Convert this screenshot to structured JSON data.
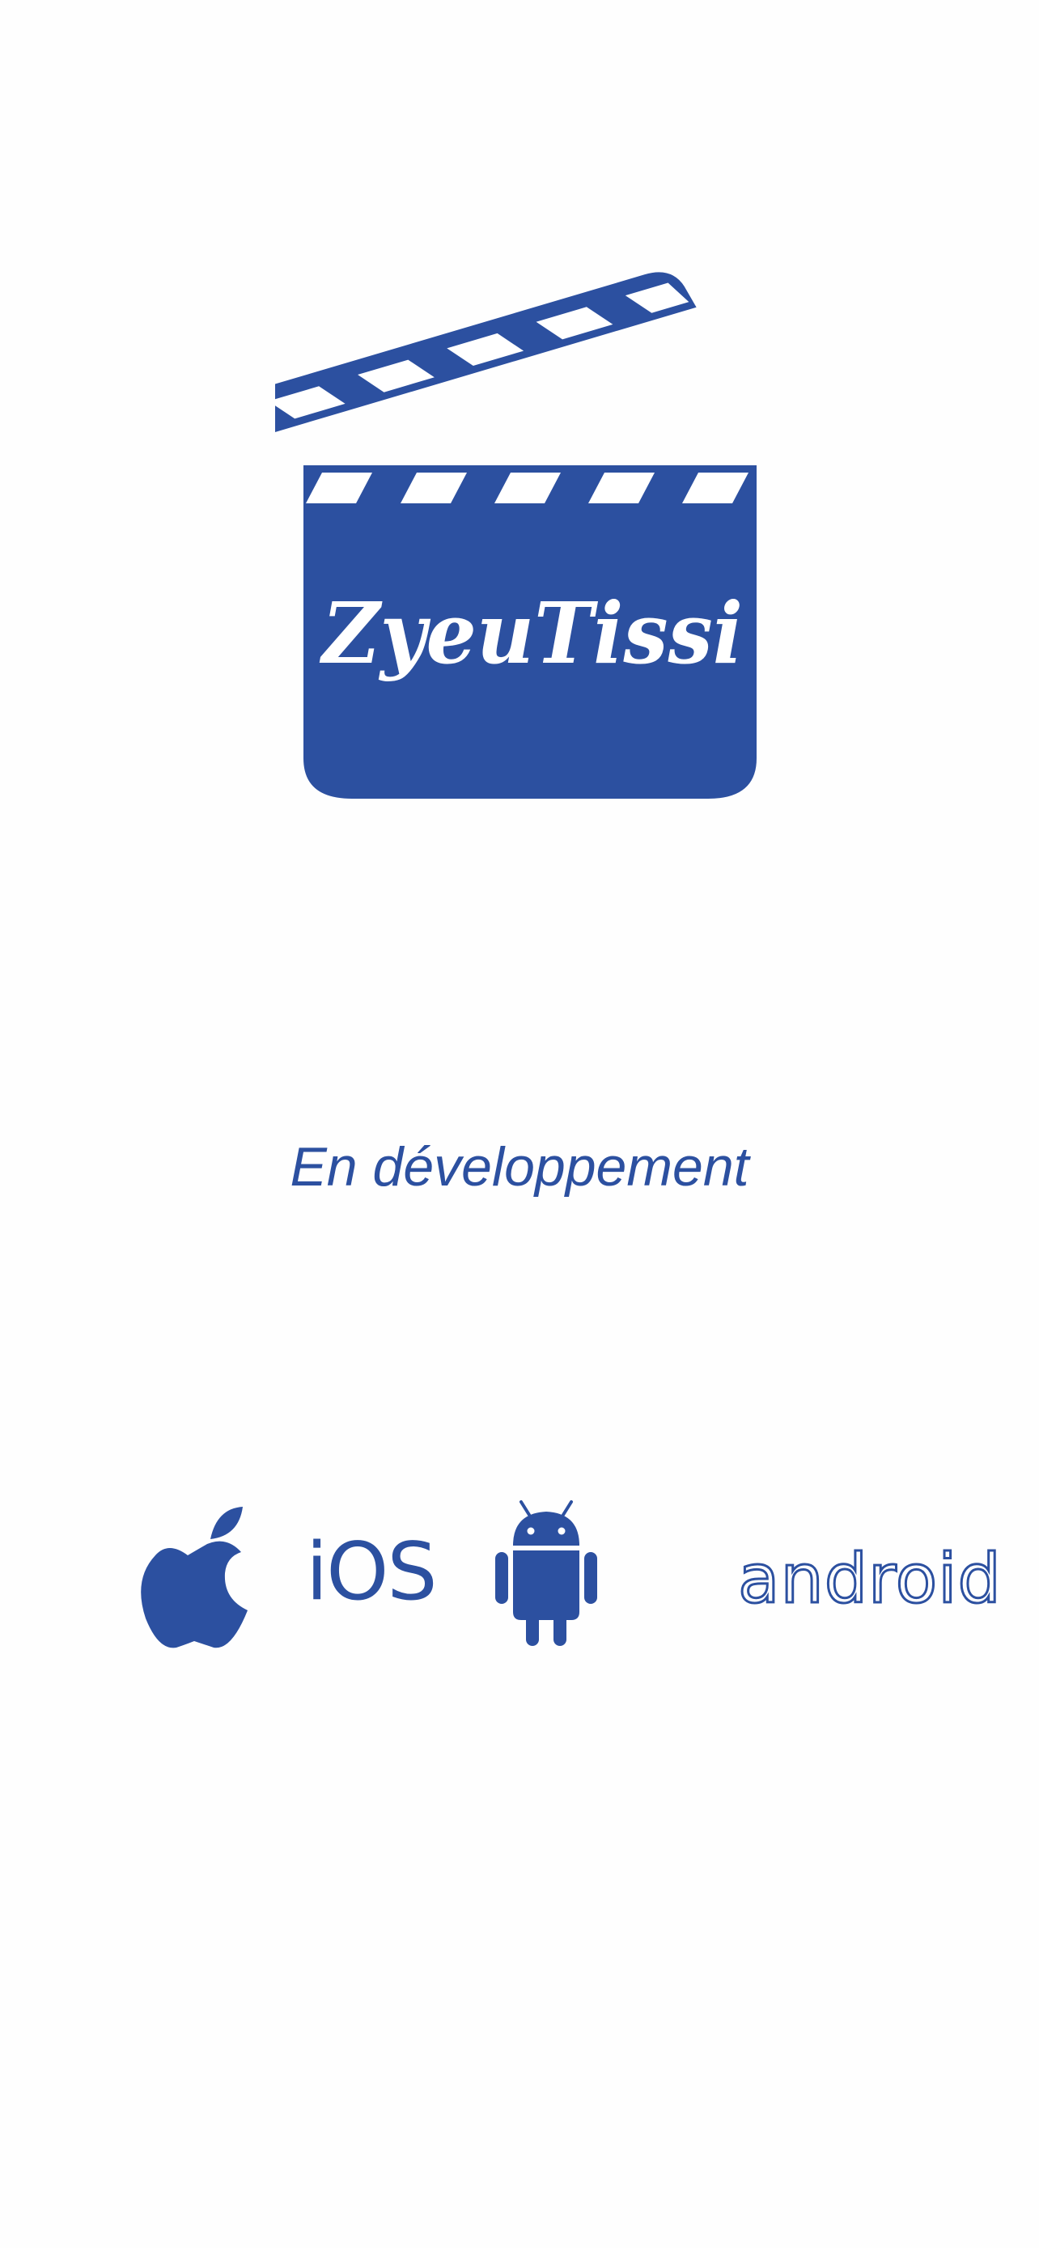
{
  "app": {
    "logo_text": "ZyeuTissi",
    "logo_icon": "clapperboard-icon"
  },
  "status": {
    "label": "En développement"
  },
  "platforms": [
    {
      "label": "iOS",
      "icon": "apple-icon"
    },
    {
      "label": "android",
      "icon": "android-robot-icon"
    }
  ],
  "colors": {
    "brand_blue": "#2c50a0",
    "background": "#fefefe",
    "logo_text": "#ffffff"
  }
}
